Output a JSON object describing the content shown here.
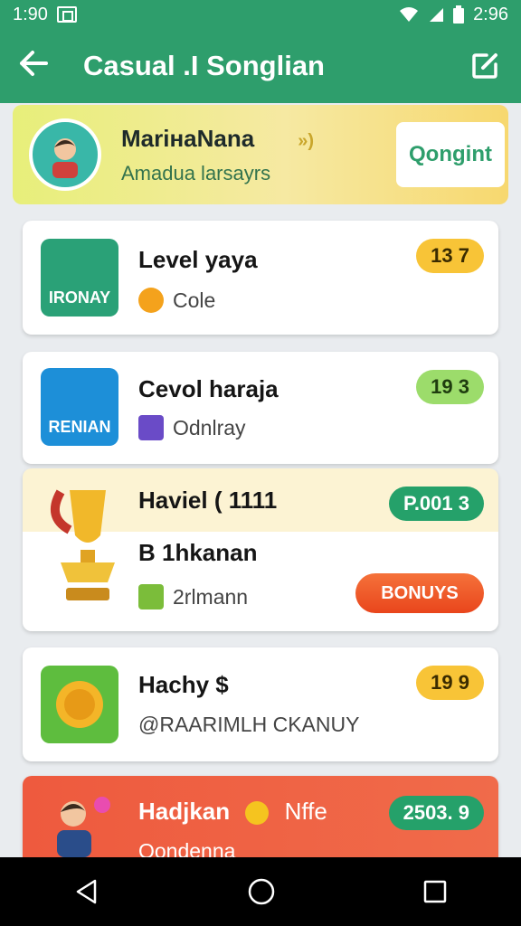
{
  "status": {
    "time": "1:90",
    "right_time": "2:96"
  },
  "appbar": {
    "title": "Casual .I Songlian"
  },
  "profile": {
    "name": "MariнaNana",
    "name_symbol": "»)",
    "subtitle": "Amadua larsayrs",
    "button": "Qongint"
  },
  "items": [
    {
      "title": "Level yaya",
      "sub": "Cole",
      "icon_label": "IRONAY",
      "badge": "13 7",
      "badge_color": "#f8c437"
    },
    {
      "title": "Cevol haraja",
      "sub": "Odnlray",
      "icon_label": "RENIAN",
      "badge": "19 3",
      "badge_color": "#9cdc6b"
    },
    {
      "title": "Haviel ( 1111",
      "line2": "B 1hkanan",
      "sub": "2rlmann",
      "badge": "P.001 3",
      "badge_color": "#25a16a",
      "bonus": "BONUYS"
    },
    {
      "title": "Hachy $",
      "sub": "@RAARIMLH CKANUY",
      "badge": "19 9",
      "badge_color": "#f8c437"
    },
    {
      "title": "Hadjkan",
      "title_extra": "Nffe",
      "sub": "Qondenna",
      "badge": "2503. 9",
      "badge_color": "#25a16a"
    }
  ]
}
